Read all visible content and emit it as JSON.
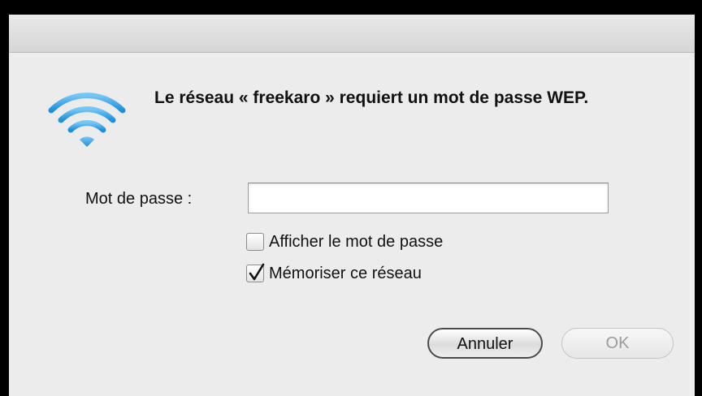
{
  "dialog": {
    "message": "Le réseau « freekaro » requiert un mot de passe WEP.",
    "icon": "wifi-icon",
    "password": {
      "label": "Mot de passe :",
      "value": ""
    },
    "checkboxes": [
      {
        "label": "Afficher le mot de passe",
        "checked": false
      },
      {
        "label": "Mémoriser ce réseau",
        "checked": true
      }
    ],
    "buttons": {
      "cancel_label": "Annuler",
      "ok_label": "OK",
      "ok_enabled": false
    }
  },
  "colors": {
    "wifi_blue": "#2a9be0",
    "dialog_bg": "#ececec"
  }
}
